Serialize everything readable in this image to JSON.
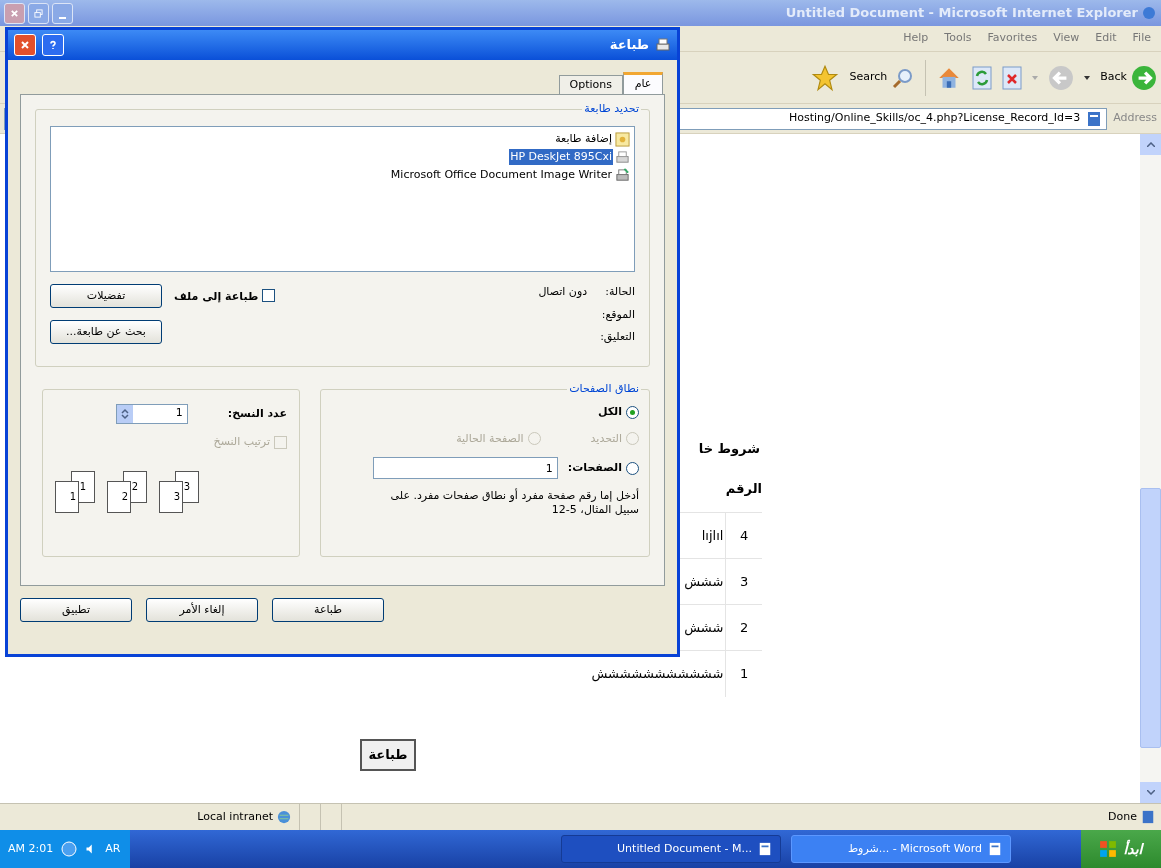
{
  "browser": {
    "title": "Untitled Document - Microsoft Internet Explorer",
    "menu": [
      "File",
      "Edit",
      "View",
      "Favorites",
      "Tools",
      "Help"
    ],
    "toolbar": {
      "back": "Back",
      "search": "Search"
    },
    "address": {
      "label": "Address",
      "url": "Hosting/Online_Skills/oc_4.php?License_Record_Id=3"
    },
    "page": {
      "heading": "شروط خا",
      "table": {
        "columns": [
          "الرقم"
        ],
        "rows": [
          {
            "number": "4",
            "text": "lıjlıl"
          },
          {
            "number": "3",
            "text": "ششش"
          },
          {
            "number": "2",
            "text": "ششش"
          },
          {
            "number": "1",
            "text": "ششششششششششش"
          }
        ]
      },
      "print_button": "طباعة"
    },
    "status_bar": {
      "status": "Done",
      "zone": "Local intranet"
    }
  },
  "dialog": {
    "title": "طباعة",
    "tabs": [
      {
        "label": "عام",
        "selected": true
      },
      {
        "label": "Options",
        "selected": false
      }
    ],
    "printer_group": {
      "title": "تحديد طابعة",
      "printers": [
        {
          "kind": "add",
          "name": "إضافة طابعة",
          "selected": false
        },
        {
          "kind": "printer",
          "name": "HP DeskJet 895Cxi",
          "selected": true
        },
        {
          "kind": "writer",
          "name": "Microsoft Office Document Image Writer",
          "selected": false
        }
      ],
      "status": [
        {
          "label": "الحالة:",
          "value": "دون اتصال"
        },
        {
          "label": "الموقع:"
        },
        {
          "label": "التعليق:"
        }
      ],
      "print_to_file": {
        "label": "طباعة إلى ملف",
        "checked": false
      },
      "preferences_button": "تفضيلات",
      "find_printer_button": "بحث عن طابعة..."
    },
    "page_range": {
      "title": "نطاق الصفحات",
      "options": [
        {
          "label": "الكل",
          "selected": true,
          "disabled": false
        },
        {
          "label": "التحديد",
          "selected": false,
          "disabled": true
        },
        {
          "label": "الصفحة الحالية",
          "selected": false,
          "disabled": true
        },
        {
          "label": "الصفحات:",
          "selected": false,
          "disabled": false,
          "value": "1"
        }
      ],
      "hint": "أدخل إما رقم صفحة مفرد أو نطاق صفحات مفرد. على سبيل المثال، 5-12"
    },
    "copies": {
      "label": "عدد النسخ:",
      "value": "1",
      "collate": {
        "label": "ترتيب النسخ",
        "checked": false,
        "disabled": true
      },
      "pages": [
        "1",
        "1",
        "2",
        "2",
        "3",
        "3"
      ]
    },
    "buttons": [
      "طباعة",
      "إلغاء الأمر",
      "تطبيق"
    ]
  },
  "taskbar": {
    "start": "ابدأ",
    "tasks": [
      {
        "label": "شروط... - Microsoft Word",
        "selected": false
      },
      {
        "label": "Untitled Document - M...",
        "selected": true
      }
    ],
    "language": "AR",
    "clock": "AM 2:01"
  }
}
